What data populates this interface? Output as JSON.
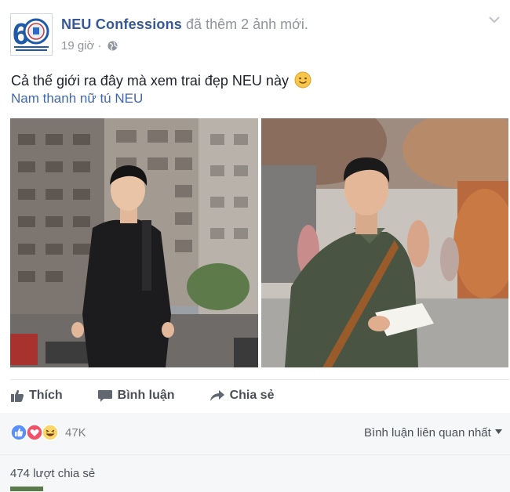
{
  "post": {
    "page_name": "NEU Confessions",
    "action_text": "đã thêm 2 ảnh mới.",
    "timestamp": "19 giờ",
    "privacy_icon": "globe-icon",
    "avatar_icon": "neu-60-anniversary-logo",
    "menu_icon": "chevron-down-icon",
    "text": "Cả thế giới ra đây mà xem trai đẹp NEU này",
    "emoji": "slightly-smiling-face",
    "hashtag": "Nam thanh nữ tú NEU",
    "photos": [
      "man-in-black-suit-city-street",
      "man-in-olive-polo-holding-paper"
    ]
  },
  "actions": {
    "like_label": "Thích",
    "comment_label": "Bình luận",
    "share_label": "Chia sẻ"
  },
  "reactions": {
    "icons": [
      "like",
      "love",
      "haha"
    ],
    "count": "47K",
    "sort_label": "Bình luận liên quan nhất"
  },
  "shares": {
    "label": "474 lượt chia sẻ"
  },
  "colors": {
    "link": "#365899",
    "hashtag": "#4267b2",
    "muted": "#90949c",
    "like_blue": "#5890ff",
    "love_red": "#f25268",
    "haha_yellow": "#fcd669"
  }
}
